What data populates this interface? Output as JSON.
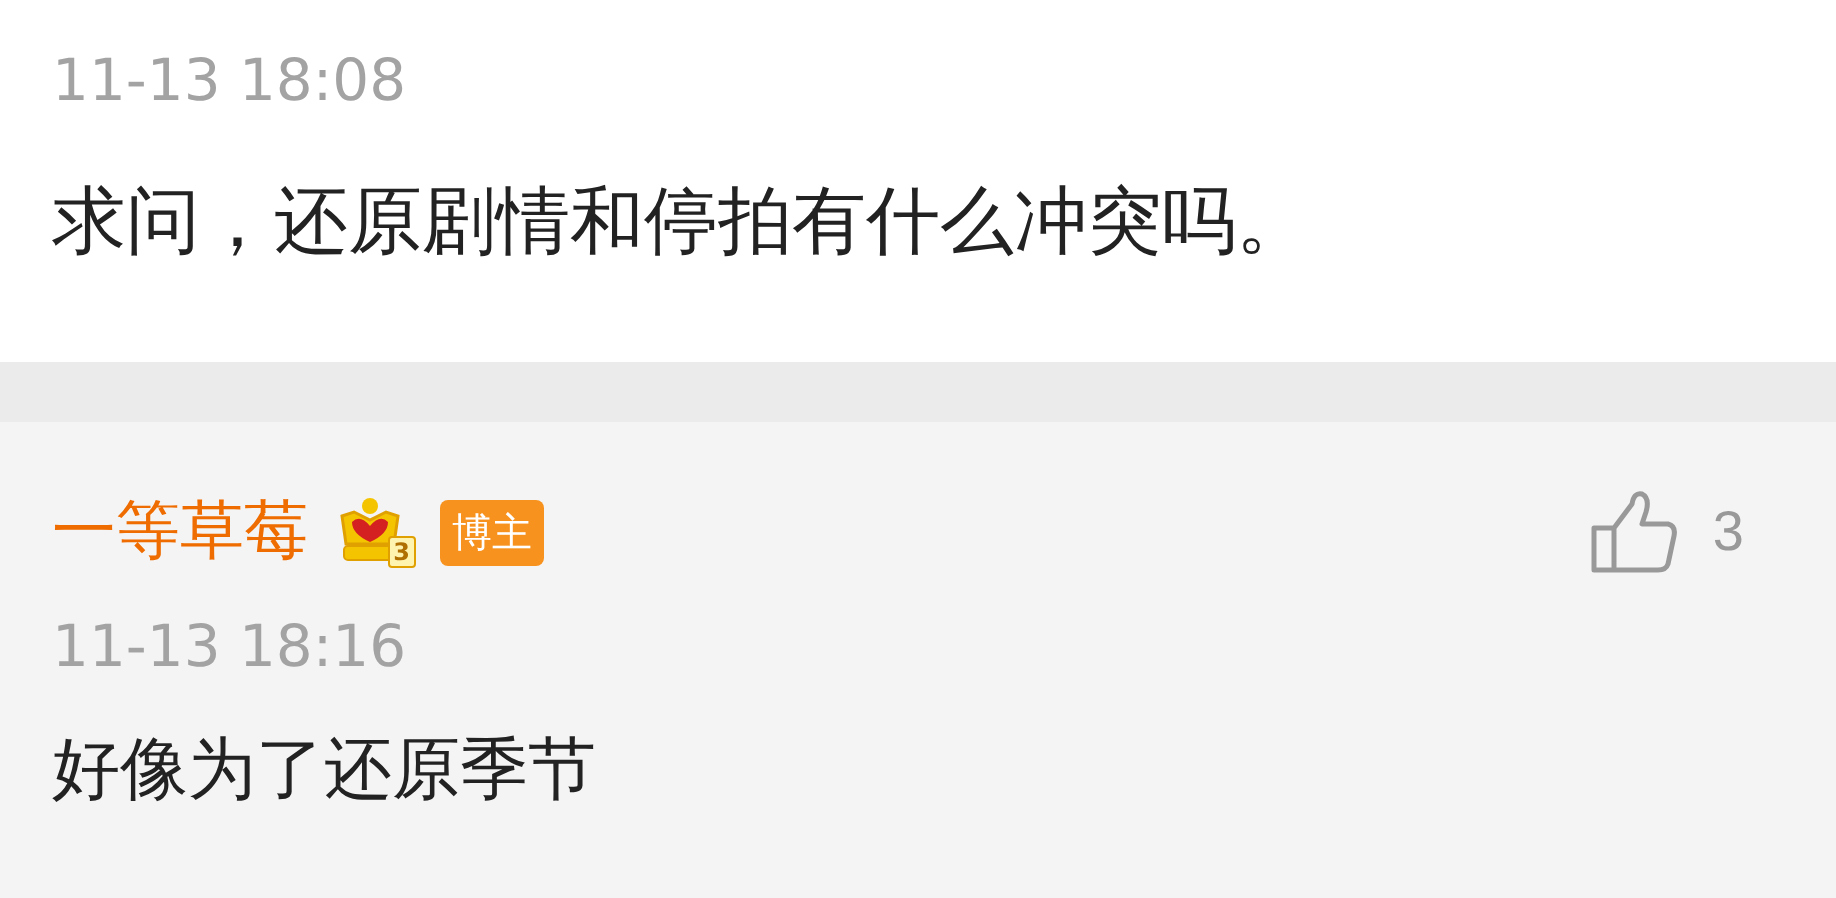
{
  "post": {
    "time": "11-13 18:08",
    "text": "求问，还原剧情和停拍有什么冲突吗。"
  },
  "reply": {
    "username": "一等草莓",
    "level_badge": "3",
    "role_badge": "博主",
    "like_count": "3",
    "time": "11-13 18:16",
    "text": "好像为了还原季节"
  }
}
